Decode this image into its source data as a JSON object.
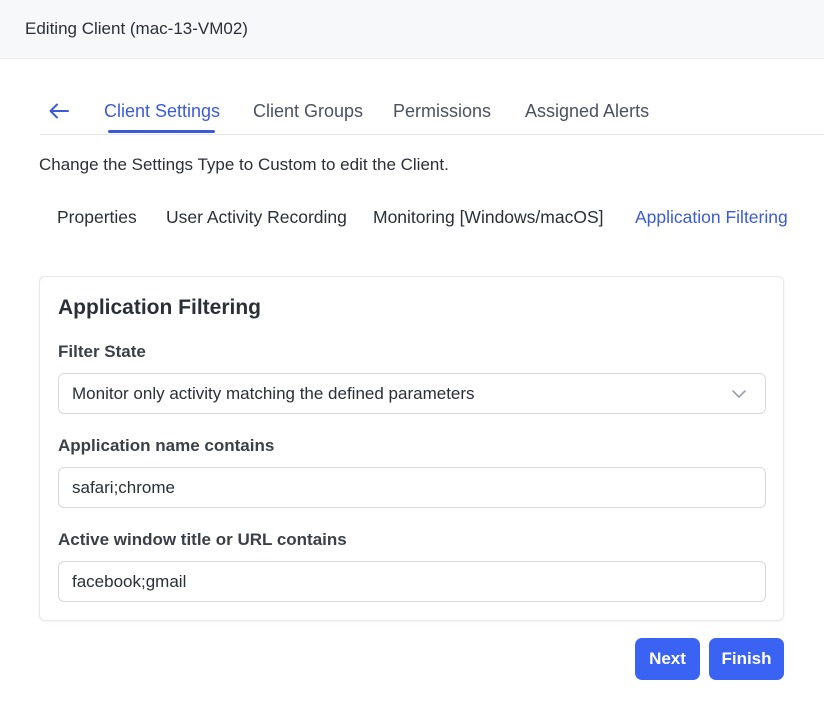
{
  "window": {
    "title": "Editing Client (mac-13-VM02)"
  },
  "tabs": [
    {
      "label": "Client Settings",
      "active": true
    },
    {
      "label": "Client Groups",
      "active": false
    },
    {
      "label": "Permissions",
      "active": false
    },
    {
      "label": "Assigned Alerts",
      "active": false
    }
  ],
  "notice": "Change the Settings Type to Custom to edit the Client.",
  "subtabs": [
    {
      "label": "Properties",
      "active": false
    },
    {
      "label": "User Activity Recording",
      "active": false
    },
    {
      "label": "Monitoring [Windows/macOS]",
      "active": false
    },
    {
      "label": "Application Filtering",
      "active": true
    }
  ],
  "card": {
    "title": "Application Filtering",
    "filter_state": {
      "label": "Filter State",
      "value": "Monitor only activity matching the defined parameters"
    },
    "app_name": {
      "label": "Application name contains",
      "value": "safari;chrome"
    },
    "window_title": {
      "label": "Active window title or URL contains",
      "value": "facebook;gmail"
    }
  },
  "buttons": {
    "next": "Next",
    "finish": "Finish"
  },
  "colors": {
    "accent": "#3b5bdb",
    "button": "#3b63f3"
  },
  "icons": {
    "back": "arrow-left-icon",
    "dropdown": "chevron-down-icon"
  }
}
